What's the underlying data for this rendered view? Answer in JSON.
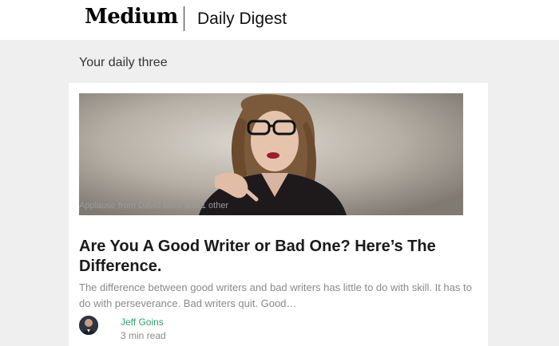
{
  "header": {
    "logo": "Medium",
    "title": "Daily Digest"
  },
  "section": {
    "title": "Your daily three"
  },
  "article": {
    "applause": "Applause from David Mike and 1 other",
    "headline": "Are You A Good Writer or Bad One? Here’s The Difference.",
    "excerpt": "The difference between good writers and bad writers has little to do with skill. It has to do with perseverance. Bad writers quit. Good…",
    "author": "Jeff Goins",
    "read_time": "3 min read"
  },
  "colors": {
    "author_link": "#2fa36b",
    "page_background": "#efefef"
  }
}
